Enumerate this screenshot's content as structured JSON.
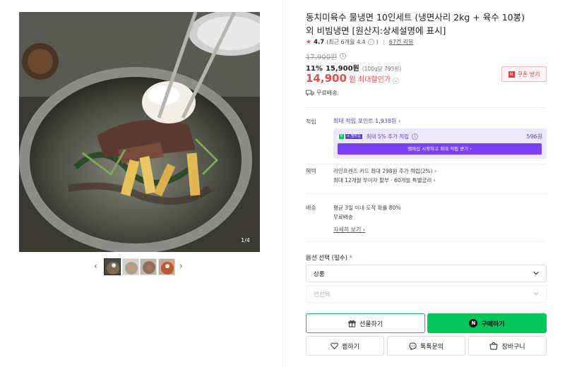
{
  "gallery": {
    "counter": "1/4",
    "prev_arrow": "‹",
    "next_arrow": "›",
    "thumbnails": [
      "thumb-1",
      "thumb-2",
      "thumb-3",
      "thumb-4"
    ]
  },
  "product": {
    "title": "동치미육수 물냉면 10인세트 (냉면사리 2kg + 육수 10봉) 외 비빔냉면 [원산지:상세설명에 표시]",
    "rating": "4.7",
    "rating_detail": "(최근 6개월 4.4",
    "rating_detail_close": ")",
    "reviews": "67건 리뷰",
    "original_price": "17,900원",
    "discount_pct": "11%",
    "discount_price": "15,900원",
    "unit_price": "(100g당 795원)",
    "final_price": "14,900",
    "final_won": "원",
    "final_label": "최대할인가",
    "coupon_label": "쿠폰 받기",
    "shipping_label": "무료배송"
  },
  "points": {
    "row_label": "적립",
    "link": "최대 적립 포인트 1,938원 ›",
    "badge_n": "N",
    "badge_plus": "+ 멤버십",
    "extra_text": "최대 5% 추가 적립",
    "extra_amount": "596원",
    "cta": "멤버십 시작하고 최대 적립 받기 ›"
  },
  "benefits": {
    "row_label": "혜택",
    "line1": "라인프렌즈 카드 최대 298원 추가 적립(2%) ›",
    "line2": "최대 12개월 무이자 할부 · 60개월 특별금리 ›"
  },
  "delivery": {
    "row_label": "배송",
    "line1": "평균 3일 이내 도착 확률 80%",
    "line2": "무료배송",
    "detail_link": "자세히 보기 ›"
  },
  "options": {
    "label": "옵션 선택 (필수)",
    "required_mark": "*",
    "select1": "상품",
    "select2": "면선택"
  },
  "actions": {
    "gift": "선물하기",
    "buy": "구매하기",
    "buy_icon": "N",
    "wish": "찜하기",
    "talk": "톡톡문의",
    "cart": "장바구니"
  },
  "colors": {
    "accent_red": "#f04a4a",
    "naver_green": "#03c75a",
    "membership_purple": "#7b3ef2"
  }
}
